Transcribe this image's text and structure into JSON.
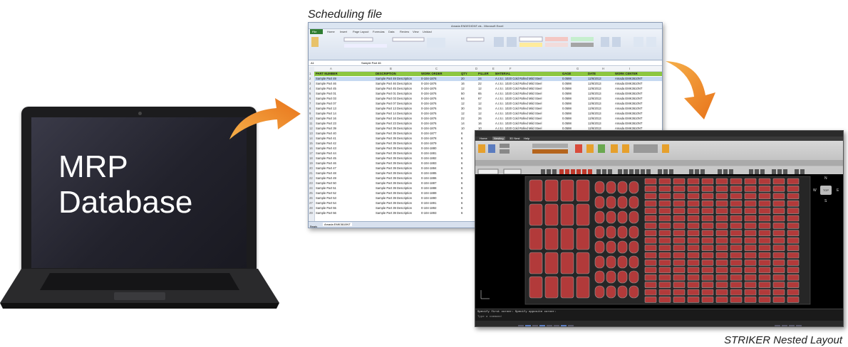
{
  "laptop": {
    "label_line1": "MRP",
    "label_line2": "Database"
  },
  "spreadsheet": {
    "caption": "Scheduling file",
    "window_title": "Amada ENDEDIDNT.xls - Microsoft Excel",
    "ribbon_tabs": [
      "File",
      "Home",
      "Insert",
      "Page Layout",
      "Formulas",
      "Data",
      "Review",
      "View",
      "Unidad"
    ],
    "name_box": "A1",
    "formula_value": "Sample Part 46",
    "columns": [
      "A",
      "B",
      "C",
      "D",
      "E",
      "F",
      "G",
      "H",
      "I"
    ],
    "headers": [
      "PART NUMBER",
      "DESCRIPTION",
      "WORK ORDER",
      "QTY",
      "FILLER",
      "MATERIAL",
      "GAGE",
      "DATE",
      "WORK CENTER"
    ],
    "rows": [
      [
        "Sample Part 49",
        "Sample Part 49 Description",
        "0-104-1876",
        "20",
        "24",
        "A.I.S.I. 1020 Cold Rolled Mild Steel",
        "0.0598",
        "12/6/2013",
        "Amada EMK3610NT"
      ],
      [
        "Sample Part 46",
        "Sample Part 46 Description",
        "0-104-1876",
        "16",
        "22",
        "A.I.S.I. 1020 Cold Rolled Mild Steel",
        "0.0598",
        "12/6/2013",
        "Amada EMK3610NT"
      ],
      [
        "Sample Part 45",
        "Sample Part 45 Description",
        "0-104-1876",
        "12",
        "12",
        "A.I.S.I. 1020 Cold Rolled Mild Steel",
        "0.0598",
        "12/6/2013",
        "Amada EMK3610NT"
      ],
      [
        "Sample Part 01",
        "Sample Part 01 Description",
        "0-104-1876",
        "50",
        "65",
        "A.I.S.I. 1020 Cold Rolled Mild Steel",
        "0.0598",
        "12/6/2013",
        "Amada EMK3610NT"
      ],
      [
        "Sample Part 03",
        "Sample Part 03 Description",
        "0-104-1876",
        "64",
        "67",
        "A.I.S.I. 1020 Cold Rolled Mild Steel",
        "0.0598",
        "12/6/2013",
        "Amada EMK3610NT"
      ],
      [
        "Sample Part 07",
        "Sample Part 07 Description",
        "0-104-1876",
        "12",
        "12",
        "A.I.S.I. 1020 Cold Rolled Mild Steel",
        "0.0598",
        "12/6/2013",
        "Amada EMK3610NT"
      ],
      [
        "Sample Part 13",
        "Sample Part 13 Description",
        "0-104-1876",
        "30",
        "34",
        "A.I.S.I. 1020 Cold Rolled Mild Steel",
        "0.0598",
        "12/6/2013",
        "Amada EMK3610NT"
      ],
      [
        "Sample Part 14",
        "Sample Part 14 Description",
        "0-104-1876",
        "12",
        "12",
        "A.I.S.I. 1020 Cold Rolled Mild Steel",
        "0.0598",
        "12/6/2013",
        "Amada EMK3610NT"
      ],
      [
        "Sample Part 16",
        "Sample Part 16 Description",
        "0-104-1876",
        "22",
        "26",
        "A.I.S.I. 1020 Cold Rolled Mild Steel",
        "0.0598",
        "12/6/2013",
        "Amada EMK3610NT"
      ],
      [
        "Sample Part 23",
        "Sample Part 23 Description",
        "0-104-1876",
        "14",
        "16",
        "A.I.S.I. 1020 Cold Rolled Mild Steel",
        "0.0598",
        "12/6/2013",
        "Amada EMK3610NT"
      ],
      [
        "Sample Part 39",
        "Sample Part 39 Description",
        "0-104-1876",
        "10",
        "10",
        "A.I.S.I. 1020 Cold Rolled Mild Steel",
        "0.0598",
        "12/6/2013",
        "Amada EMK3610NT"
      ],
      [
        "Sample Part 40",
        "Sample Part 39 Description",
        "0-104-1877",
        "6",
        "6",
        "A.I.S.I. 1020 Cold Rolled Mild Steel",
        "0.0598",
        "12/7/2013",
        "Amada EMK3610NT"
      ],
      [
        "Sample Part 41",
        "Sample Part 39 Description",
        "0-104-1878",
        "6",
        "6",
        "A.I.S.I. 1020 Cold Rolled Mild Steel",
        "1.0598",
        "12/7/2013",
        "Amada EMK3610NT"
      ],
      [
        "Sample Part 42",
        "Sample Part 39 Description",
        "0-104-1879",
        "6",
        "6",
        "",
        "",
        "",
        ""
      ],
      [
        "Sample Part 43",
        "Sample Part 39 Description",
        "0-104-1880",
        "6",
        "6",
        "",
        "",
        "",
        ""
      ],
      [
        "Sample Part 44",
        "Sample Part 39 Description",
        "0-104-1881",
        "6",
        "6",
        "",
        "",
        "",
        ""
      ],
      [
        "Sample Part 45",
        "Sample Part 39 Description",
        "0-104-1882",
        "6",
        "6",
        "",
        "",
        "",
        ""
      ],
      [
        "Sample Part 46",
        "Sample Part 39 Description",
        "0-104-1883",
        "6",
        "6",
        "",
        "",
        "",
        ""
      ],
      [
        "Sample Part 47",
        "Sample Part 39 Description",
        "0-104-1884",
        "6",
        "6",
        "",
        "",
        "",
        ""
      ],
      [
        "Sample Part 48",
        "Sample Part 39 Description",
        "0-104-1885",
        "6",
        "6",
        "",
        "",
        "",
        ""
      ],
      [
        "Sample Part 49",
        "Sample Part 39 Description",
        "0-104-1886",
        "6",
        "6",
        "",
        "",
        "",
        ""
      ],
      [
        "Sample Part 50",
        "Sample Part 39 Description",
        "0-104-1887",
        "6",
        "6",
        "",
        "",
        "",
        ""
      ],
      [
        "Sample Part 51",
        "Sample Part 39 Description",
        "0-104-1888",
        "6",
        "6",
        "",
        "",
        "",
        ""
      ],
      [
        "Sample Part 52",
        "Sample Part 39 Description",
        "0-104-1889",
        "6",
        "6",
        "",
        "",
        "",
        ""
      ],
      [
        "Sample Part 53",
        "Sample Part 39 Description",
        "0-104-1890",
        "6",
        "6",
        "",
        "",
        "",
        ""
      ],
      [
        "Sample Part 54",
        "Sample Part 39 Description",
        "0-104-1891",
        "6",
        "6",
        "",
        "",
        "",
        ""
      ],
      [
        "Sample Part 55",
        "Sample Part 39 Description",
        "0-104-1892",
        "6",
        "6",
        "",
        "",
        "",
        ""
      ],
      [
        "Sample Part 56",
        "Sample Part 39 Description",
        "0-104-1893",
        "6",
        "6",
        "",
        "",
        "",
        ""
      ]
    ],
    "sheet_tab": "Amada EMK3610NT",
    "status": "Ready"
  },
  "cad": {
    "caption": "STRIKER Nested Layout",
    "ribbon_tabs": [
      "Home",
      "Nesting",
      "3D Nest",
      "Help"
    ],
    "command_line1": "Specify first corner: Specify opposite corner:",
    "command_line2": "Type a command",
    "compass": {
      "n": "N",
      "w": "W",
      "e": "E",
      "s": "S",
      "top": "TOP"
    }
  },
  "colors": {
    "arrow": "#f28c1e",
    "excel_header_green": "#8cc63f",
    "cad_part_fill": "#b23a3a",
    "cad_part_outline": "#9a9a9a"
  }
}
